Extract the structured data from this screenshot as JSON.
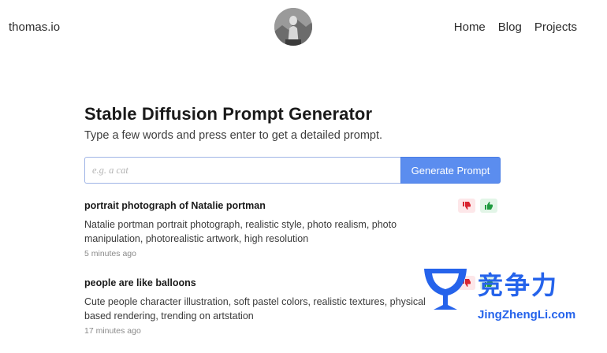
{
  "header": {
    "brand": "thomas.io",
    "nav": [
      {
        "label": "Home"
      },
      {
        "label": "Blog"
      },
      {
        "label": "Projects"
      }
    ]
  },
  "main": {
    "title": "Stable Diffusion Prompt Generator",
    "subtitle": "Type a few words and press enter to get a detailed prompt.",
    "input_placeholder": "e.g. a cat",
    "input_value": "",
    "button_label": "Generate Prompt"
  },
  "results": [
    {
      "title": "portrait photograph of Natalie portman",
      "prompt": "Natalie portman portrait photograph, realistic style, photo realism, photo manipulation, photorealistic artwork, high resolution",
      "time": "5 minutes ago"
    },
    {
      "title": "people are like balloons",
      "prompt": "Cute people character illustration, soft pastel colors, realistic textures, physical based rendering, trending on artstation",
      "time": "17 minutes ago"
    }
  ],
  "icons": {
    "thumbs_down": "thumbs-down-icon",
    "thumbs_up": "thumbs-up-icon"
  },
  "colors": {
    "accent": "#5b8def",
    "thumbs_down": "#d9232f",
    "thumbs_up": "#1f9a3f",
    "watermark": "#2563eb"
  },
  "watermark": {
    "cn": "竞争力",
    "en": "JingZhengLi.com"
  }
}
